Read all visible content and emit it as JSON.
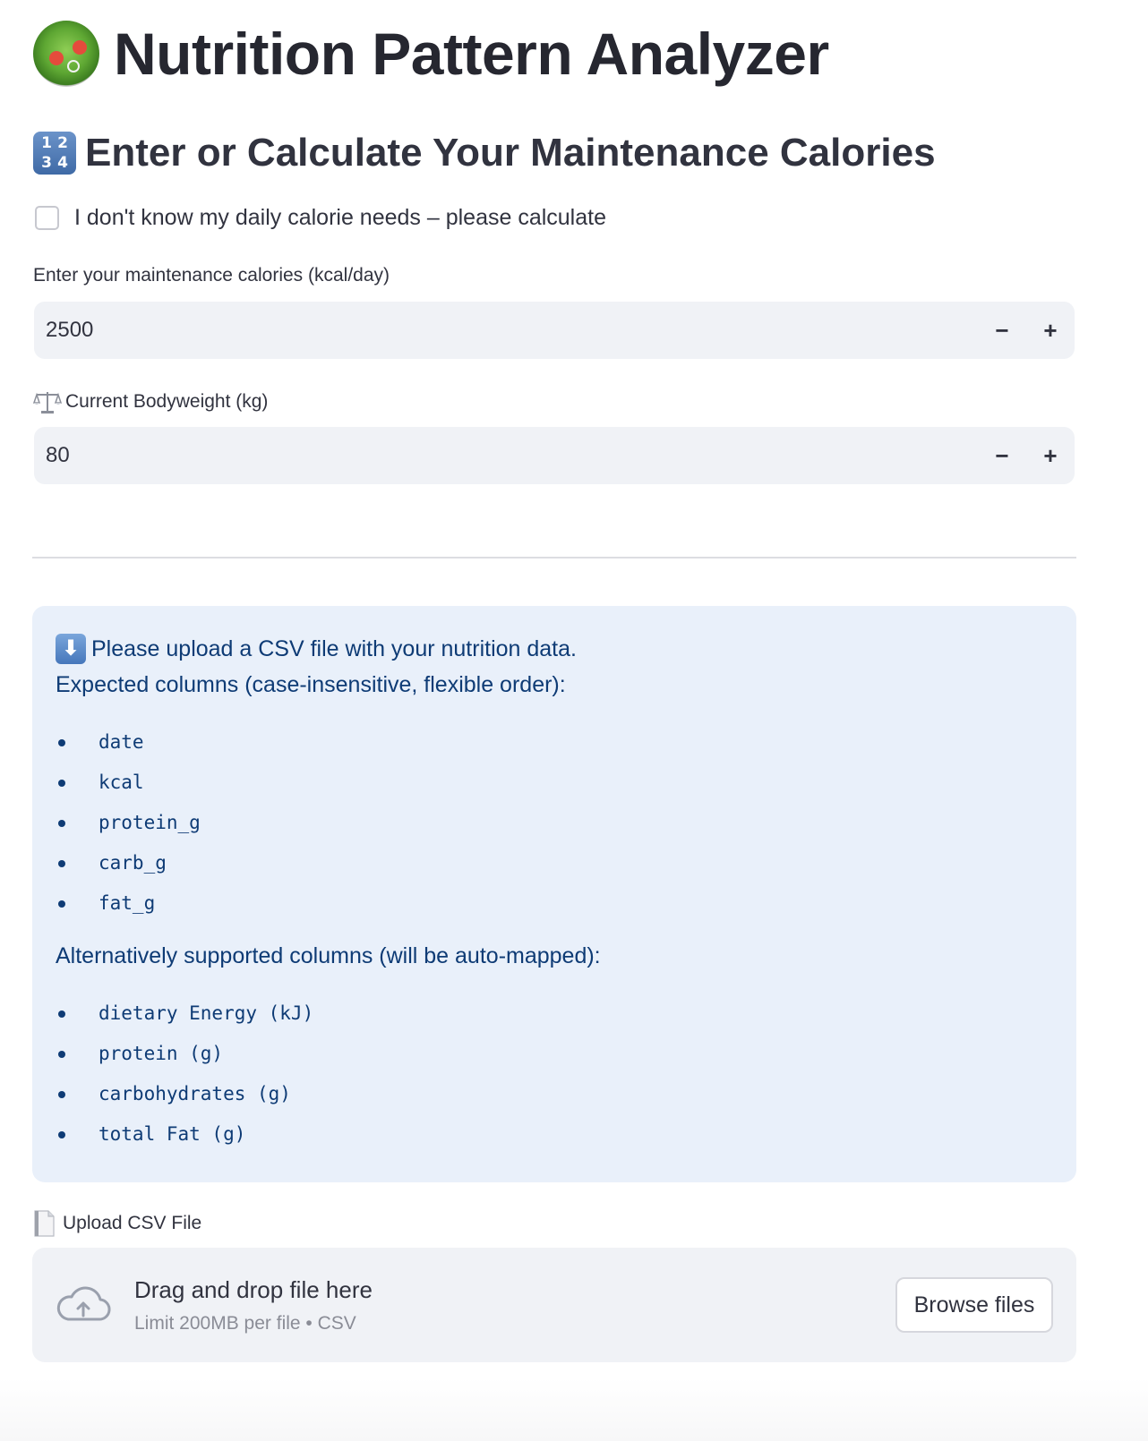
{
  "header": {
    "title": "Nutrition Pattern Analyzer",
    "title_icon": "green-salad-icon"
  },
  "section": {
    "subheader": "Enter or Calculate Your Maintenance Calories",
    "subheader_icon": "input-numbers-icon",
    "icon_digits": [
      "1",
      "2",
      "3",
      "4"
    ]
  },
  "calculate_checkbox": {
    "label": "I don't know my daily calorie needs – please calculate",
    "checked": false
  },
  "maintenance_input": {
    "label": "Enter your maintenance calories (kcal/day)",
    "value": "2500",
    "decrement": "−",
    "increment": "+"
  },
  "bodyweight_input": {
    "label": "Current Bodyweight (kg)",
    "label_icon": "balance-scale-icon",
    "value": "80",
    "decrement": "−",
    "increment": "+"
  },
  "info_box": {
    "icon": "down-arrow-icon",
    "icon_glyph": "⬇",
    "line1": "Please upload a CSV file with your nutrition data.",
    "line2": "Expected columns (case-insensitive, flexible order):",
    "expected_columns": [
      "date",
      "kcal",
      "protein_g",
      "carb_g",
      "fat_g"
    ],
    "alt_heading": "Alternatively supported columns (will be auto-mapped):",
    "alt_columns": [
      "dietary Energy (kJ)",
      "protein (g)",
      "carbohydrates (g)",
      "total Fat (g)"
    ],
    "background": "#e9f0fa",
    "text_color": "#0e3b75"
  },
  "uploader": {
    "label": "Upload CSV File",
    "label_icon": "page-facing-up-icon",
    "drop_text": "Drag and drop file here",
    "limit_text": "Limit 200MB per file • CSV",
    "browse_label": "Browse files",
    "cloud_icon": "cloud-upload-icon"
  }
}
